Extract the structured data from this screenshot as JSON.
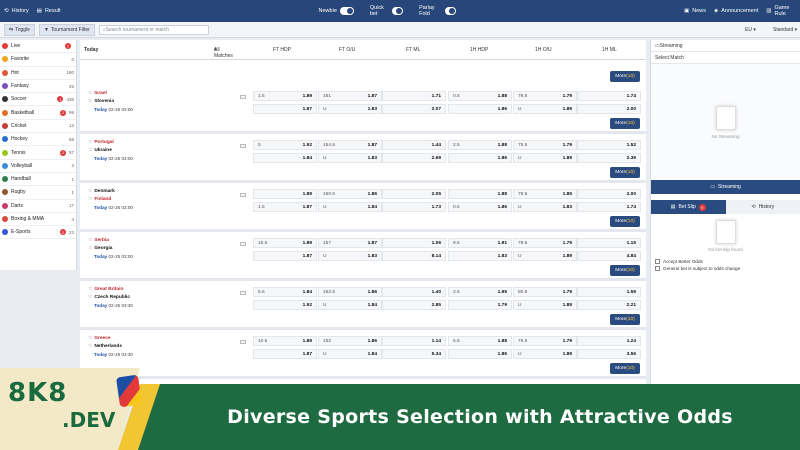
{
  "topbar": {
    "history": "History",
    "result": "Result",
    "newbie": "Newbie",
    "quickbet": "Quick bet",
    "parlay": "Parlay Fold",
    "news": "News",
    "announcement": "Announcement",
    "gamerules": "Game Rule"
  },
  "subbar": {
    "toggle": "Toggle",
    "filter": "Tournament Filter",
    "search_placeholder": "Search tournament or match",
    "odds_format": "EU",
    "view": "Standard"
  },
  "sidebar": [
    {
      "name": "Live",
      "count": "",
      "badge": "7",
      "color": "#e23a3a"
    },
    {
      "name": "Favorite",
      "count": "0",
      "badge": "",
      "color": "#f2a31b"
    },
    {
      "name": "Hot",
      "count": "180",
      "badge": "",
      "color": "#e2563a"
    },
    {
      "name": "Fantasy",
      "count": "25",
      "badge": "",
      "color": "#7b4fb8"
    },
    {
      "name": "Soccer",
      "count": "435",
      "badge": "1",
      "color": "#333333"
    },
    {
      "name": "Basketball",
      "count": "98",
      "badge": "2",
      "color": "#e0712b"
    },
    {
      "name": "Cricket",
      "count": "13",
      "badge": "",
      "color": "#c93a3a"
    },
    {
      "name": "Hockey",
      "count": "68",
      "badge": "",
      "color": "#2b6cc9"
    },
    {
      "name": "Tennis",
      "count": "57",
      "badge": "2",
      "color": "#9ac91b"
    },
    {
      "name": "Volleyball",
      "count": "3",
      "badge": "",
      "color": "#3a8fd6"
    },
    {
      "name": "Handball",
      "count": "1",
      "badge": "",
      "color": "#2b7f4a"
    },
    {
      "name": "Rugby",
      "count": "1",
      "badge": "",
      "color": "#8a5a2b"
    },
    {
      "name": "Darts",
      "count": "17",
      "badge": "",
      "color": "#c93a6c"
    },
    {
      "name": "Boxing & MMA",
      "count": "4",
      "badge": "",
      "color": "#d64b3a"
    },
    {
      "name": "E-Sports",
      "count": "23",
      "badge": "2",
      "color": "#3a55d6"
    }
  ],
  "main": {
    "today": "Today",
    "all_matches": "All Matches",
    "cols": [
      "FT HDP",
      "FT O/U",
      "FT ML",
      "1H HDP",
      "1H O/U",
      "1H ML"
    ],
    "more_label": "More",
    "more_count": "(10)"
  },
  "matches": [
    {
      "home": "Israel",
      "away": "Slovenia",
      "day": "Today",
      "time": "02-25 03:00",
      "r1": [
        "1.5",
        "1.89",
        "161",
        "1.87",
        "1.71",
        "0.5",
        "1.88",
        "79.5",
        "1.79",
        "1.74"
      ],
      "r2": [
        "",
        "1.87",
        "U",
        "1.83",
        "2.07",
        "",
        "1.86",
        "U",
        "1.89",
        "2.00"
      ],
      "red": "home"
    },
    {
      "home": "Portugal",
      "away": "Ukraine",
      "day": "Today",
      "time": "02-25 03:00",
      "r1": [
        "5",
        "1.92",
        "154.5",
        "1.87",
        "1.44",
        "2.5",
        "1.88",
        "75.5",
        "1.79",
        "1.52"
      ],
      "r2": [
        "",
        "1.84",
        "U",
        "1.83",
        "2.69",
        "",
        "1.86",
        "U",
        "1.89",
        "2.36"
      ],
      "red": "home"
    },
    {
      "home": "Denmark",
      "away": "Finland",
      "day": "Today",
      "time": "02-25 03:00",
      "r1": [
        "",
        "1.89",
        "160.5",
        "1.86",
        "2.05",
        "",
        "1.88",
        "79.5",
        "1.85",
        "2.00"
      ],
      "r2": [
        "1.5",
        "1.87",
        "U",
        "1.84",
        "1.73",
        "0.5",
        "1.86",
        "U",
        "1.83",
        "1.74"
      ],
      "red": "away"
    },
    {
      "home": "Serbia",
      "away": "Georgia",
      "day": "Today",
      "time": "02-25 03:00",
      "r1": [
        "16.5",
        "1.89",
        "157",
        "1.87",
        "1.06",
        "9.5",
        "1.91",
        "78.5",
        "1.79",
        "1.15"
      ],
      "r2": [
        "",
        "1.87",
        "U",
        "1.83",
        "8.14",
        "",
        "1.83",
        "U",
        "1.89",
        "4.84"
      ],
      "red": "home"
    },
    {
      "home": "Great Britain",
      "away": "Czech Republic",
      "day": "Today",
      "time": "02-25 03:30",
      "r1": [
        "5.5",
        "1.84",
        "162.5",
        "1.86",
        "1.40",
        "2.5",
        "1.95",
        "80.5",
        "1.79",
        "1.59"
      ],
      "r2": [
        "",
        "1.92",
        "U",
        "1.84",
        "2.85",
        "",
        "1.79",
        "U",
        "1.89",
        "2.21"
      ],
      "red": "home"
    },
    {
      "home": "Greece",
      "away": "Netherlands",
      "day": "Today",
      "time": "02-25 03:30",
      "r1": [
        "10.5",
        "1.89",
        "152",
        "1.86",
        "1.14",
        "5.5",
        "1.88",
        "75.5",
        "1.79",
        "1.24"
      ],
      "r2": [
        "",
        "1.87",
        "U",
        "1.84",
        "5.34",
        "",
        "1.86",
        "U",
        "1.89",
        "3.56"
      ],
      "red": "home"
    }
  ],
  "right": {
    "streaming_title": "Streaming",
    "select_match": "Select Match",
    "no_streaming": "No Streaming",
    "streaming_btn": "Streaming",
    "betslip": "Bet Slip",
    "betslip_count": "0",
    "history": "History",
    "no_bet": "No bet slip found",
    "accept": "Accept Better Odds",
    "general": "General bet is subject to odds change"
  },
  "banner": {
    "brand_top": "8K8",
    "brand_bottom": ".DEV",
    "slogan": "Diverse Sports Selection with Attractive Odds"
  }
}
